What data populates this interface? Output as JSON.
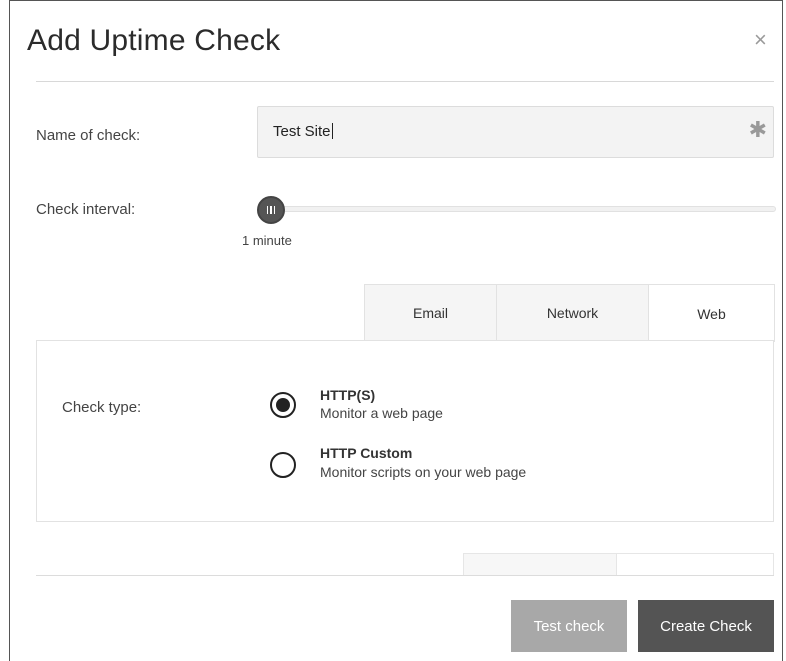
{
  "dialog": {
    "title": "Add Uptime Check",
    "close_icon": "×"
  },
  "form": {
    "name_label": "Name of check:",
    "name_value": "Test Site",
    "required_icon": "✱",
    "interval_label": "Check interval:",
    "interval_value_text": "1 minute",
    "interval_slider_position": 0
  },
  "tabs": [
    {
      "label": "Email",
      "active": false
    },
    {
      "label": "Network",
      "active": false
    },
    {
      "label": "Web",
      "active": true
    }
  ],
  "web_panel": {
    "check_type_label": "Check type:",
    "options": [
      {
        "title": "HTTP(S)",
        "description": "Monitor a web page",
        "selected": true
      },
      {
        "title": "HTTP Custom",
        "description": "Monitor scripts on your web page",
        "selected": false
      }
    ]
  },
  "footer": {
    "test_label": "Test check",
    "create_label": "Create Check"
  },
  "colors": {
    "primary_button": "#545454",
    "disabled_button": "#a8a8a8",
    "input_background": "#f3f3f3"
  }
}
